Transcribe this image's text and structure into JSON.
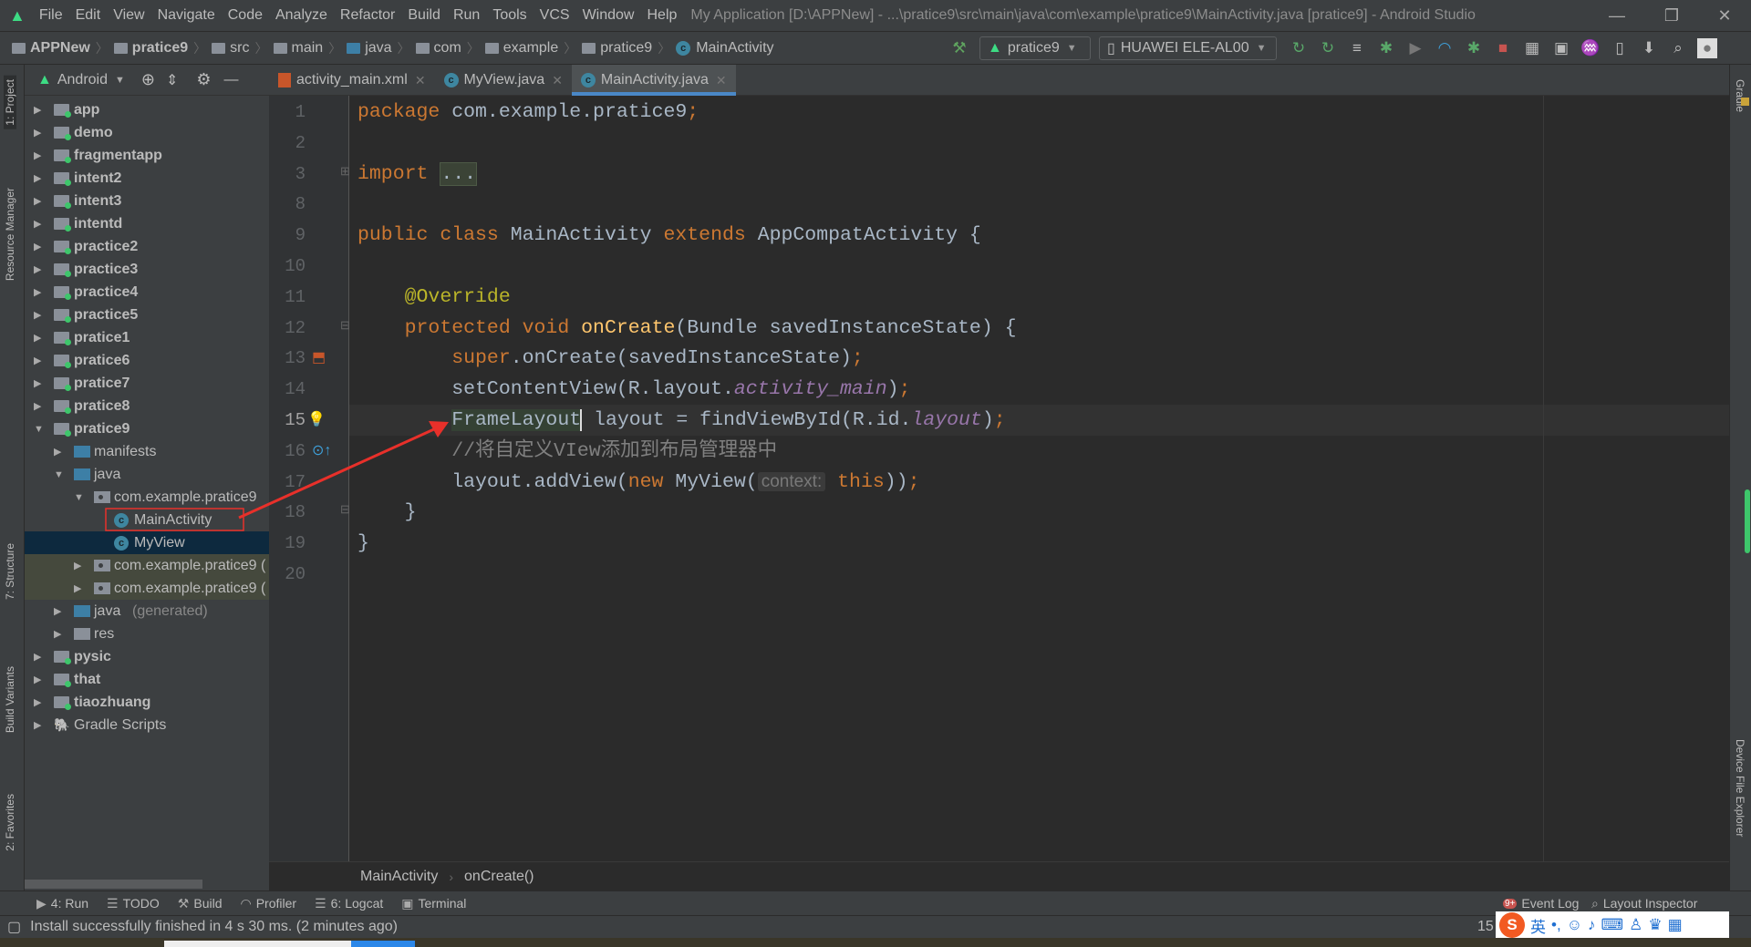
{
  "titlebar": {
    "menu": [
      "File",
      "Edit",
      "View",
      "Navigate",
      "Code",
      "Analyze",
      "Refactor",
      "Build",
      "Run",
      "Tools",
      "VCS",
      "Window",
      "Help"
    ],
    "title": "My Application [D:\\APPNew] - ...\\pratice9\\src\\main\\java\\com\\example\\pratice9\\MainActivity.java [pratice9] - Android Studio",
    "minimize": "—",
    "restore": "❐",
    "close": "✕"
  },
  "navbar": {
    "breadcrumbs": [
      "APPNew",
      "pratice9",
      "src",
      "main",
      "java",
      "com",
      "example",
      "pratice9",
      "MainActivity"
    ],
    "run_config": "pratice9",
    "device": "HUAWEI ELE-AL00"
  },
  "project_panel": {
    "view": "Android",
    "tree": [
      {
        "label": "app",
        "level": 0,
        "type": "module",
        "expanded": false
      },
      {
        "label": "demo",
        "level": 0,
        "type": "module",
        "expanded": false
      },
      {
        "label": "fragmentapp",
        "level": 0,
        "type": "module",
        "expanded": false
      },
      {
        "label": "intent2",
        "level": 0,
        "type": "module",
        "expanded": false
      },
      {
        "label": "intent3",
        "level": 0,
        "type": "module",
        "expanded": false
      },
      {
        "label": "intentd",
        "level": 0,
        "type": "module",
        "expanded": false
      },
      {
        "label": "practice2",
        "level": 0,
        "type": "module",
        "expanded": false
      },
      {
        "label": "practice3",
        "level": 0,
        "type": "module",
        "expanded": false
      },
      {
        "label": "practice4",
        "level": 0,
        "type": "module",
        "expanded": false
      },
      {
        "label": "practice5",
        "level": 0,
        "type": "module",
        "expanded": false
      },
      {
        "label": "pratice1",
        "level": 0,
        "type": "module",
        "expanded": false
      },
      {
        "label": "pratice6",
        "level": 0,
        "type": "module",
        "expanded": false
      },
      {
        "label": "pratice7",
        "level": 0,
        "type": "module",
        "expanded": false
      },
      {
        "label": "pratice8",
        "level": 0,
        "type": "module",
        "expanded": false
      },
      {
        "label": "pratice9",
        "level": 0,
        "type": "module",
        "expanded": true
      },
      {
        "label": "manifests",
        "level": 1,
        "type": "src",
        "expanded": false
      },
      {
        "label": "java",
        "level": 1,
        "type": "src",
        "expanded": true
      },
      {
        "label": "com.example.pratice9",
        "level": 2,
        "type": "package",
        "expanded": true
      },
      {
        "label": "MainActivity",
        "level": 3,
        "type": "class",
        "highlighted": true
      },
      {
        "label": "MyView",
        "level": 3,
        "type": "class",
        "selected": true
      },
      {
        "label": "com.example.pratice9 (",
        "level": 2,
        "type": "package",
        "expanded": false,
        "test": true
      },
      {
        "label": "com.example.pratice9 (",
        "level": 2,
        "type": "package",
        "expanded": false,
        "test": true
      },
      {
        "label": "java",
        "hint": "(generated)",
        "level": 1,
        "type": "src",
        "expanded": false
      },
      {
        "label": "res",
        "level": 1,
        "type": "res",
        "expanded": false
      },
      {
        "label": "pysic",
        "level": 0,
        "type": "module",
        "expanded": false
      },
      {
        "label": "that",
        "level": 0,
        "type": "module",
        "expanded": false
      },
      {
        "label": "tiaozhuang",
        "level": 0,
        "type": "module",
        "expanded": false
      },
      {
        "label": "Gradle Scripts",
        "level": 0,
        "type": "gradle",
        "expanded": false
      }
    ]
  },
  "tabs": [
    {
      "label": "activity_main.xml",
      "icon": "xml-layout-icon"
    },
    {
      "label": "MyView.java",
      "icon": "class-icon"
    },
    {
      "label": "MainActivity.java",
      "icon": "class-icon",
      "active": true
    }
  ],
  "editor": {
    "current_line": "15",
    "lines": [
      {
        "n": "1",
        "tokens": [
          [
            "package",
            "kw"
          ],
          [
            " com.example.pratice9",
            ""
          ],
          [
            ";",
            "kw"
          ]
        ]
      },
      {
        "n": "2",
        "tokens": []
      },
      {
        "n": "3",
        "tokens": [
          [
            "import",
            "kw"
          ],
          [
            " ",
            ""
          ],
          [
            "...",
            "fold"
          ]
        ]
      },
      {
        "n": "8",
        "tokens": []
      },
      {
        "n": "9",
        "tokens": [
          [
            "public class",
            "kw"
          ],
          [
            " MainActivity ",
            ""
          ],
          [
            "extends",
            "kw"
          ],
          [
            " AppCompatActivity {",
            ""
          ]
        ]
      },
      {
        "n": "10",
        "tokens": []
      },
      {
        "n": "11",
        "tokens": [
          [
            "    ",
            ""
          ],
          [
            "@Override",
            "an"
          ]
        ]
      },
      {
        "n": "12",
        "tokens": [
          [
            "    ",
            ""
          ],
          [
            "protected void",
            "kw"
          ],
          [
            " ",
            ""
          ],
          [
            "onCreate",
            "fn"
          ],
          [
            "(Bundle savedInstanceState) {",
            ""
          ]
        ]
      },
      {
        "n": "13",
        "tokens": [
          [
            "        ",
            ""
          ],
          [
            "super",
            "kw"
          ],
          [
            ".onCreate(savedInstanceState)",
            ""
          ],
          [
            ";",
            "kw"
          ]
        ]
      },
      {
        "n": "14",
        "tokens": [
          [
            "        setContentView(R.layout.",
            ""
          ],
          [
            "activity_main",
            "it"
          ],
          [
            ")",
            ""
          ],
          [
            ";",
            "kw"
          ]
        ]
      },
      {
        "n": "15",
        "tokens": [
          [
            "        ",
            ""
          ],
          [
            "FrameLayout",
            "hl"
          ],
          [
            " layout = findViewById(R.id.",
            ""
          ],
          [
            "layout",
            "it"
          ],
          [
            ")",
            ""
          ],
          [
            ";",
            "kw"
          ]
        ]
      },
      {
        "n": "16",
        "tokens": [
          [
            "        //将自定义VIew添加到布局管理器中",
            "cm"
          ]
        ]
      },
      {
        "n": "17",
        "tokens": [
          [
            "        layout.addView(",
            ""
          ],
          [
            "new",
            "kw"
          ],
          [
            " MyView(",
            ""
          ],
          [
            "context:",
            "hint"
          ],
          [
            " ",
            ""
          ],
          [
            "this",
            "kw"
          ],
          [
            "))",
            ""
          ],
          [
            ";",
            "kw"
          ]
        ]
      },
      {
        "n": "18",
        "tokens": [
          [
            "    }",
            ""
          ]
        ]
      },
      {
        "n": "19",
        "tokens": [
          [
            "}",
            ""
          ]
        ]
      },
      {
        "n": "20",
        "tokens": []
      }
    ]
  },
  "breadcrumb": [
    "MainActivity",
    "onCreate()"
  ],
  "side_tools": {
    "left": [
      "1: Project",
      "Resource Manager",
      "7: Structure",
      "Build Variants",
      "2: Favorites"
    ],
    "right": [
      "Gradle",
      "Device File Explorer"
    ]
  },
  "bottom_tools": {
    "left": [
      "4: Run",
      "TODO",
      "Build",
      "Profiler",
      "6: Logcat",
      "Terminal"
    ],
    "event_log": "Event Log",
    "event_badge": "9+",
    "layout_inspector": "Layout Inspector"
  },
  "status": {
    "message": "Install successfully finished in 4 s 30 ms. (2 minutes ago)",
    "position": "15"
  },
  "ime": {
    "label": "英"
  },
  "colors": {
    "accent": "#4a88c7",
    "annotation_arrow": "#e8302a",
    "keyword": "#cc7832",
    "function": "#ffc66d",
    "field": "#9876aa",
    "comment": "#808080"
  }
}
